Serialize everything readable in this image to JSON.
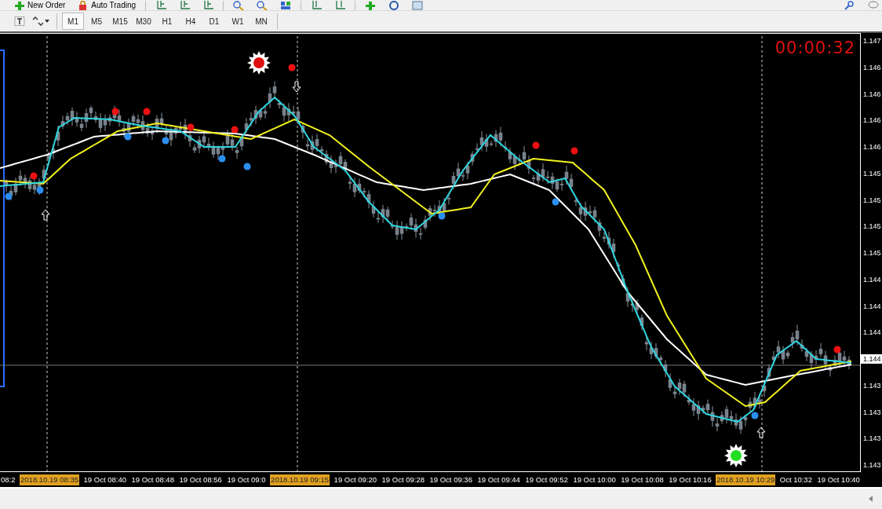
{
  "toolbar": {
    "buttons": [
      {
        "label": "New Order"
      },
      {
        "label": "Auto Trading"
      }
    ]
  },
  "timeframes": [
    {
      "label": "M1",
      "selected": true
    },
    {
      "label": "M5",
      "selected": false
    },
    {
      "label": "M15",
      "selected": false
    },
    {
      "label": "M30",
      "selected": false
    },
    {
      "label": "H1",
      "selected": false
    },
    {
      "label": "H4",
      "selected": false
    },
    {
      "label": "D1",
      "selected": false
    },
    {
      "label": "W1",
      "selected": false
    },
    {
      "label": "MN",
      "selected": false
    }
  ],
  "chart": {
    "timer": "00:00:32",
    "price_labels": [
      {
        "label": "1.147",
        "current": false
      },
      {
        "label": "1.146",
        "current": false
      },
      {
        "label": "1.146",
        "current": false
      },
      {
        "label": "1.146",
        "current": false
      },
      {
        "label": "1.146",
        "current": false
      },
      {
        "label": "1.145",
        "current": false
      },
      {
        "label": "1.145",
        "current": false
      },
      {
        "label": "1.145",
        "current": false
      },
      {
        "label": "1.145",
        "current": false
      },
      {
        "label": "1.144",
        "current": false
      },
      {
        "label": "1.144",
        "current": false
      },
      {
        "label": "1.144",
        "current": false
      },
      {
        "label": "1.144",
        "current": true
      },
      {
        "label": "1.143",
        "current": false
      },
      {
        "label": "1.143",
        "current": false
      },
      {
        "label": "1.143",
        "current": false
      },
      {
        "label": "1.143",
        "current": false
      }
    ],
    "time_labels": [
      {
        "label": "08:2",
        "highlighted": false
      },
      {
        "label": "2018.10.19 08:35",
        "highlighted": true
      },
      {
        "label": "19 Oct 08:40",
        "highlighted": false
      },
      {
        "label": "19 Oct 08:48",
        "highlighted": false
      },
      {
        "label": "19 Oct 08:56",
        "highlighted": false
      },
      {
        "label": "19 Oct 09:0",
        "highlighted": false
      },
      {
        "label": "2018.10.19 09:15",
        "highlighted": true
      },
      {
        "label": "19 Oct 09:20",
        "highlighted": false
      },
      {
        "label": "19 Oct 09:28",
        "highlighted": false
      },
      {
        "label": "19 Oct 09:36",
        "highlighted": false
      },
      {
        "label": "19 Oct 09:44",
        "highlighted": false
      },
      {
        "label": "19 Oct 09:52",
        "highlighted": false
      },
      {
        "label": "19 Oct 10:00",
        "highlighted": false
      },
      {
        "label": "19 Oct 10:08",
        "highlighted": false
      },
      {
        "label": "19 Oct 10:16",
        "highlighted": false
      },
      {
        "label": "2018.10.19 10:29",
        "highlighted": true
      },
      {
        "label": "Oct 10:32",
        "highlighted": false
      },
      {
        "label": "19 Oct 10:40",
        "highlighted": false
      }
    ]
  }
}
